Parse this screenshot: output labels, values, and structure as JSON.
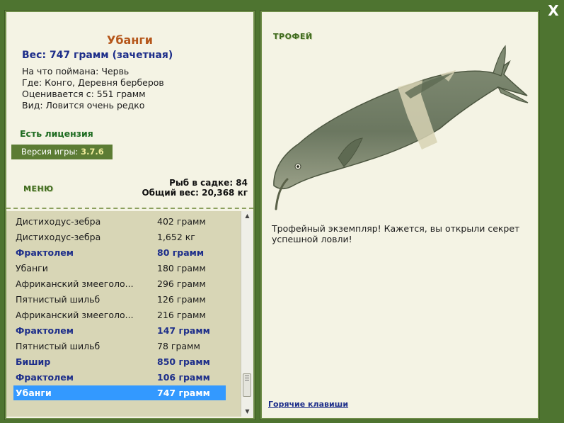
{
  "close_label": "X",
  "fish": {
    "title": "Убанги",
    "weight": "Вес: 747 грамм (зачетная)",
    "details": [
      "На что поймана: Червь",
      "Где: Конго, Деревня берберов",
      "Оценивается с: 551 грамм",
      "Вид: Ловится очень редко"
    ]
  },
  "license": "Есть лицензия",
  "version": {
    "label": "Версия игры: ",
    "value": "3.7.6"
  },
  "menu_label": "МЕНЮ",
  "cage": {
    "count": "Рыб в садке: 84",
    "total": "Общий вес: 20,368 кг"
  },
  "catch_list": [
    {
      "name": "Дистиходус-зебра",
      "weight": "402 грамм",
      "trophy": false,
      "selected": false
    },
    {
      "name": "Дистиходус-зебра",
      "weight": "1,652 кг",
      "trophy": false,
      "selected": false
    },
    {
      "name": "Фрактолем",
      "weight": "80 грамм",
      "trophy": true,
      "selected": false
    },
    {
      "name": "Убанги",
      "weight": "180 грамм",
      "trophy": false,
      "selected": false
    },
    {
      "name": "Африканский змееголо...",
      "weight": "296 грамм",
      "trophy": false,
      "selected": false
    },
    {
      "name": "Пятнистый шильб",
      "weight": "126 грамм",
      "trophy": false,
      "selected": false
    },
    {
      "name": "Африканский змееголо...",
      "weight": "216 грамм",
      "trophy": false,
      "selected": false
    },
    {
      "name": "Фрактолем",
      "weight": "147 грамм",
      "trophy": true,
      "selected": false
    },
    {
      "name": "Пятнистый шильб",
      "weight": "78 грамм",
      "trophy": false,
      "selected": false
    },
    {
      "name": "Бишир",
      "weight": "850 грамм",
      "trophy": true,
      "selected": false
    },
    {
      "name": "Фрактолем",
      "weight": "106 грамм",
      "trophy": true,
      "selected": false
    },
    {
      "name": "Убанги",
      "weight": "747 грамм",
      "trophy": true,
      "selected": true
    }
  ],
  "trophy": {
    "heading": "ТРОФЕЙ",
    "text": "Трофейный экземпляр! Кажется, вы открыли секрет успешной ловли!"
  },
  "hotkeys_link": "Горячие клавиши",
  "colors": {
    "frame_green": "#4e7430",
    "panel_bg": "#f4f3e4",
    "title_orange": "#b5561a",
    "trophy_blue": "#1d2e8a",
    "selection_blue": "#3399ff",
    "license_green": "#1d6b20"
  },
  "icons": {
    "close": "close-icon",
    "fish": "elephantfish-image",
    "scroll_up": "up-arrow-icon",
    "scroll_down": "down-arrow-icon"
  }
}
